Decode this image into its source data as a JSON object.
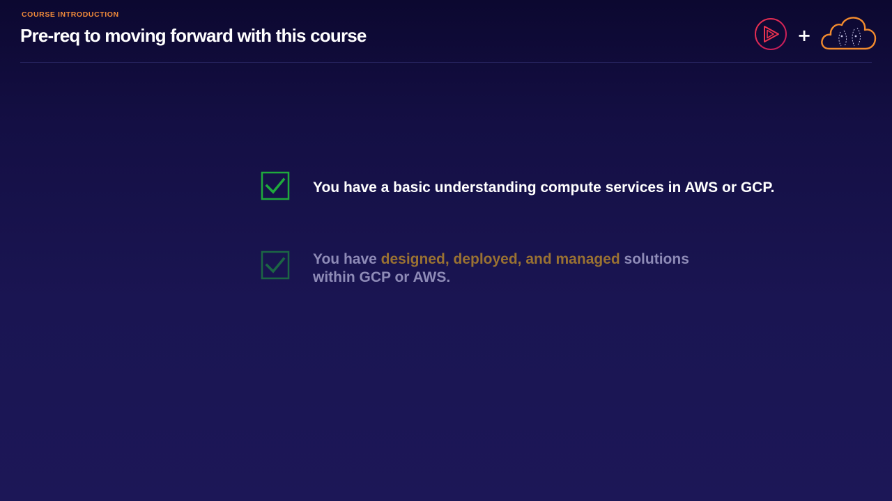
{
  "header": {
    "eyebrow": "COURSE INTRODUCTION",
    "title": "Pre-req to moving forward with this course",
    "plus": "+"
  },
  "logos": {
    "left": "pluralsight-play-logo",
    "right": "cloud-logo"
  },
  "prereqs": [
    {
      "text": "You have a basic understanding compute services in AWS or GCP.",
      "checked": true,
      "dimmed": false
    },
    {
      "text_before": "You have ",
      "highlight": "designed, deployed, and managed",
      "text_after": " solutions",
      "line2": "within GCP or AWS.",
      "checked": true,
      "dimmed": true
    }
  ],
  "colors": {
    "accent_orange": "#f28b3a",
    "check_green": "#1faa3c",
    "highlight": "#9a7232",
    "dim_text": "#8e8bb7"
  }
}
